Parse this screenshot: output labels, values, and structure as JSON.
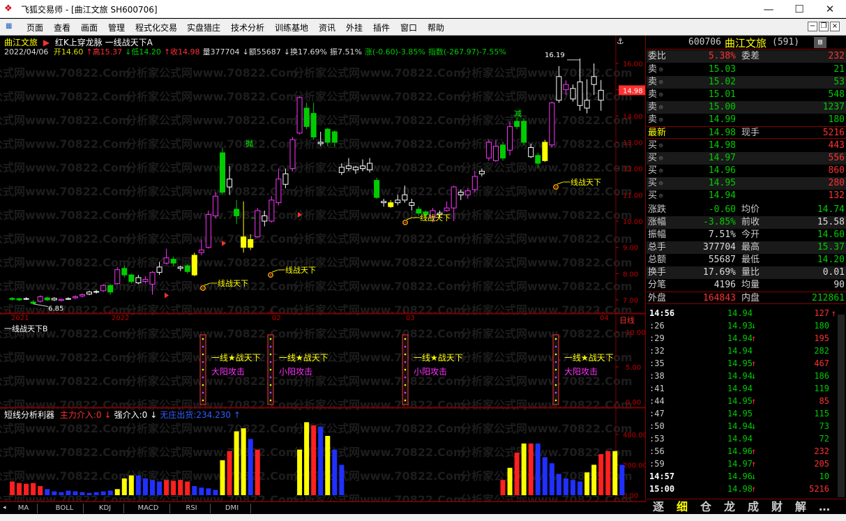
{
  "window": {
    "title": "飞狐交易师 - [曲江文旅 SH600706]",
    "controls": [
      "—",
      "☐",
      "✕"
    ]
  },
  "menu": [
    "页面",
    "查看",
    "画面",
    "管理",
    "程式化交易",
    "实盘猎庄",
    "技术分析",
    "训练基地",
    "资讯",
    "外挂",
    "插件",
    "窗口",
    "帮助"
  ],
  "main_chart": {
    "stock_name": "曲江文旅",
    "marker": "▶",
    "indicator_title": "红K上穿龙脉  一线战天下A",
    "date": "2022/04/06",
    "ohlc_line": [
      {
        "text": "开14.60",
        "color": "#dddd00"
      },
      {
        "text": "↑高15.37",
        "color": "#ff3030"
      },
      {
        "text": "↓低14.20",
        "color": "#00cc00"
      },
      {
        "text": "↑收14.98",
        "color": "#ff3030"
      },
      {
        "text": "量377704",
        "color": "#dddddd"
      },
      {
        "text": "↓额55687",
        "color": "#dddddd"
      },
      {
        "text": "↓换17.69%",
        "color": "#dddddd"
      },
      {
        "text": "振7.51%",
        "color": "#dddddd"
      },
      {
        "text": "涨(-0.60)-3.85%",
        "color": "#00cc00"
      },
      {
        "text": "指数(-267.97)-7.55%",
        "color": "#00cc00"
      }
    ],
    "price_ticks": [
      "16.00",
      "15.00",
      "14.00",
      "13.00",
      "12.00",
      "11.00",
      "10.00",
      "9.00",
      "8.00",
      "7.00"
    ],
    "current_price_tag": "14.98",
    "high_label": "16.19",
    "low_label": "6.85",
    "date_ticks": [
      "2021",
      "2022",
      "02",
      "03",
      "04"
    ],
    "period": "日线",
    "annotations": {
      "sell": "抛",
      "reduce": "减",
      "dash": "--"
    },
    "signal_label": "一线战天下"
  },
  "sub1": {
    "title": "一线战天下B",
    "ticks": [
      "10.00",
      "5.00",
      "0.00"
    ],
    "signal_main": "一线★战天下",
    "signals": [
      "大阳攻击",
      "小阳攻击",
      "小阳攻击",
      "大阳攻击"
    ]
  },
  "sub2": {
    "title": "短线分析利器",
    "legend": [
      {
        "text": "主力介入:0",
        "color": "#ff3030"
      },
      {
        "text": "↓",
        "color": "#ff3030"
      },
      {
        "text": "强介入:0",
        "color": "#ffffff"
      },
      {
        "text": "↓",
        "color": "#ffffff"
      },
      {
        "text": "无庄出货:234.230",
        "color": "#3060ff"
      },
      {
        "text": "↑",
        "color": "#3060ff"
      }
    ],
    "ticks": [
      "400.00",
      "200.00",
      "0.00"
    ]
  },
  "bottom_tabs": [
    "MA",
    "BOLL",
    "KDJ",
    "MACD",
    "RSI",
    "DMI"
  ],
  "panel": {
    "code": "600706",
    "name": "曲江文旅",
    "count": "(591)",
    "webi": {
      "label1": "委比",
      "val1": "5.38%",
      "label2": "委差",
      "val2": "232"
    },
    "asks": [
      {
        "label": "卖",
        "price": "15.03",
        "vol": "21"
      },
      {
        "label": "卖",
        "price": "15.02",
        "vol": "53"
      },
      {
        "label": "卖",
        "price": "15.01",
        "vol": "548"
      },
      {
        "label": "卖",
        "price": "15.00",
        "vol": "1237"
      },
      {
        "label": "卖",
        "price": "14.99",
        "vol": "180"
      }
    ],
    "last": {
      "label": "最新",
      "price": "14.98",
      "label2": "现手",
      "vol": "5216"
    },
    "bids": [
      {
        "label": "买",
        "price": "14.98",
        "vol": "443"
      },
      {
        "label": "买",
        "price": "14.97",
        "vol": "556"
      },
      {
        "label": "买",
        "price": "14.96",
        "vol": "860"
      },
      {
        "label": "买",
        "price": "14.95",
        "vol": "280"
      },
      {
        "label": "买",
        "price": "14.94",
        "vol": "132"
      }
    ],
    "stats": [
      {
        "l1": "涨跌",
        "v1": "-0.60",
        "c1": "#00cc00",
        "l2": "均价",
        "v2": "14.74",
        "c2": "#00cc00"
      },
      {
        "l1": "涨幅",
        "v1": "-3.85%",
        "c1": "#00cc00",
        "l2": "前收",
        "v2": "15.58",
        "c2": "#dddddd"
      },
      {
        "l1": "振幅",
        "v1": "7.51%",
        "c1": "#dddddd",
        "l2": "今开",
        "v2": "14.60",
        "c2": "#00cc00"
      },
      {
        "l1": "总手",
        "v1": "377704",
        "c1": "#dddddd",
        "l2": "最高",
        "v2": "15.37",
        "c2": "#00cc00"
      },
      {
        "l1": "总额",
        "v1": "55687",
        "c1": "#dddddd",
        "l2": "最低",
        "v2": "14.20",
        "c2": "#00cc00"
      },
      {
        "l1": "换手",
        "v1": "17.69%",
        "c1": "#dddddd",
        "l2": "量比",
        "v2": "0.01",
        "c2": "#dddddd"
      },
      {
        "l1": "分笔",
        "v1": "4196",
        "c1": "#dddddd",
        "l2": "均量",
        "v2": "90",
        "c2": "#dddddd"
      }
    ],
    "outer": {
      "l1": "外盘",
      "v1": "164843",
      "l2": "内盘",
      "v2": "212861"
    },
    "ticks": [
      {
        "t": "14:56",
        "p": "14.94",
        "a": "",
        "v": "127",
        "vc": "#ff3030",
        "va": "↑"
      },
      {
        "t": ":26",
        "p": "14.93",
        "a": "↓",
        "v": "180",
        "vc": "#00cc00",
        "va": ""
      },
      {
        "t": ":29",
        "p": "14.94",
        "a": "↑",
        "v": "195",
        "vc": "#ff3030",
        "va": ""
      },
      {
        "t": ":32",
        "p": "14.94",
        "a": "",
        "v": "282",
        "vc": "#00cc00",
        "va": ""
      },
      {
        "t": ":35",
        "p": "14.95",
        "a": "↑",
        "v": "467",
        "vc": "#ff3030",
        "va": ""
      },
      {
        "t": ":38",
        "p": "14.94",
        "a": "↓",
        "v": "186",
        "vc": "#00cc00",
        "va": ""
      },
      {
        "t": ":41",
        "p": "14.94",
        "a": "",
        "v": "119",
        "vc": "#00cc00",
        "va": ""
      },
      {
        "t": ":44",
        "p": "14.95",
        "a": "↑",
        "v": "85",
        "vc": "#ff3030",
        "va": ""
      },
      {
        "t": ":47",
        "p": "14.95",
        "a": "",
        "v": "115",
        "vc": "#00cc00",
        "va": ""
      },
      {
        "t": ":50",
        "p": "14.94",
        "a": "↓",
        "v": "73",
        "vc": "#00cc00",
        "va": ""
      },
      {
        "t": ":53",
        "p": "14.94",
        "a": "",
        "v": "72",
        "vc": "#00cc00",
        "va": ""
      },
      {
        "t": ":56",
        "p": "14.96",
        "a": "↑",
        "v": "232",
        "vc": "#ff3030",
        "va": ""
      },
      {
        "t": ":59",
        "p": "14.97",
        "a": "↑",
        "v": "205",
        "vc": "#ff3030",
        "va": ""
      },
      {
        "t": "14:57",
        "p": "14.96",
        "a": "↓",
        "v": "10",
        "vc": "#00cc00",
        "va": ""
      },
      {
        "t": "15:00",
        "p": "14.98",
        "a": "↑",
        "v": "5216",
        "vc": "#ff3030",
        "va": ""
      }
    ],
    "tabs": [
      "逐",
      "细",
      "仓",
      "龙",
      "成",
      "财",
      "解",
      "…"
    ]
  },
  "watermark": "分析家公式网www.70822.Com",
  "colors": {
    "up": "#ff30ff",
    "down": "#00cc00",
    "highlight": "#ffff00",
    "neutral": "#ffffff",
    "grid": "#800000",
    "label": "#ffff00"
  }
}
